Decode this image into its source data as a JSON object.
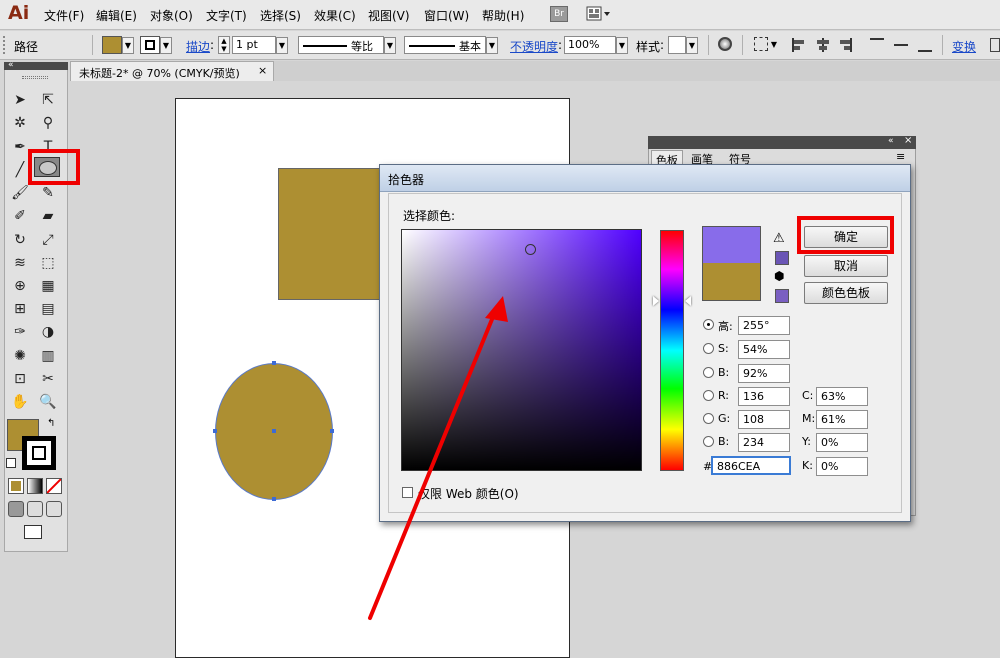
{
  "app": {
    "logo": "Ai",
    "bridge_label": "Br"
  },
  "menubar": {
    "items": [
      "文件(F)",
      "编辑(E)",
      "对象(O)",
      "文字(T)",
      "选择(S)",
      "效果(C)",
      "视图(V)",
      "窗口(W)",
      "帮助(H)"
    ]
  },
  "controlbar": {
    "selection_label": "路径",
    "stroke_link": "描边",
    "stroke_weight": "1 pt",
    "profile_label": "等比",
    "brush_label": "基本",
    "opacity_link": "不透明度",
    "opacity_value": "100%",
    "style_label": "样式",
    "transform_link": "变换",
    "fill_color": "#ad8f32"
  },
  "document": {
    "tab_title": "未标题-2* @ 70% (CMYK/预览)",
    "close_glyph": "×"
  },
  "canvas": {
    "shape_fill": "#ad8f32"
  },
  "swatches_panel": {
    "tabs": [
      "色板",
      "画笔",
      "符号"
    ],
    "collapse": "«",
    "close": "×",
    "menu": "≡"
  },
  "color_picker": {
    "title": "拾色器",
    "select_label": "选择颜色:",
    "buttons": {
      "ok": "确定",
      "cancel": "取消",
      "swatches": "颜色色板"
    },
    "new_color": "#886cea",
    "old_color": "#ad8f32",
    "warning_glyph": "⚠",
    "cube_glyph": "⬢",
    "hsb": [
      {
        "label": "高:",
        "value": "255°",
        "selected": true
      },
      {
        "label": "S:",
        "value": "54%",
        "selected": false
      },
      {
        "label": "B:",
        "value": "92%",
        "selected": false
      }
    ],
    "rgb": [
      {
        "label": "R:",
        "value": "136"
      },
      {
        "label": "G:",
        "value": "108"
      },
      {
        "label": "B:",
        "value": "234"
      }
    ],
    "cmyk": [
      {
        "label": "C:",
        "value": "63%"
      },
      {
        "label": "M:",
        "value": "61%"
      },
      {
        "label": "Y:",
        "value": "0%"
      },
      {
        "label": "K:",
        "value": "0%"
      }
    ],
    "hex_label": "#",
    "hex_value": "886CEA",
    "web_only_label": "仅限 Web 颜色(O)"
  },
  "annotation": {
    "highlight_color": "#ef0000"
  }
}
